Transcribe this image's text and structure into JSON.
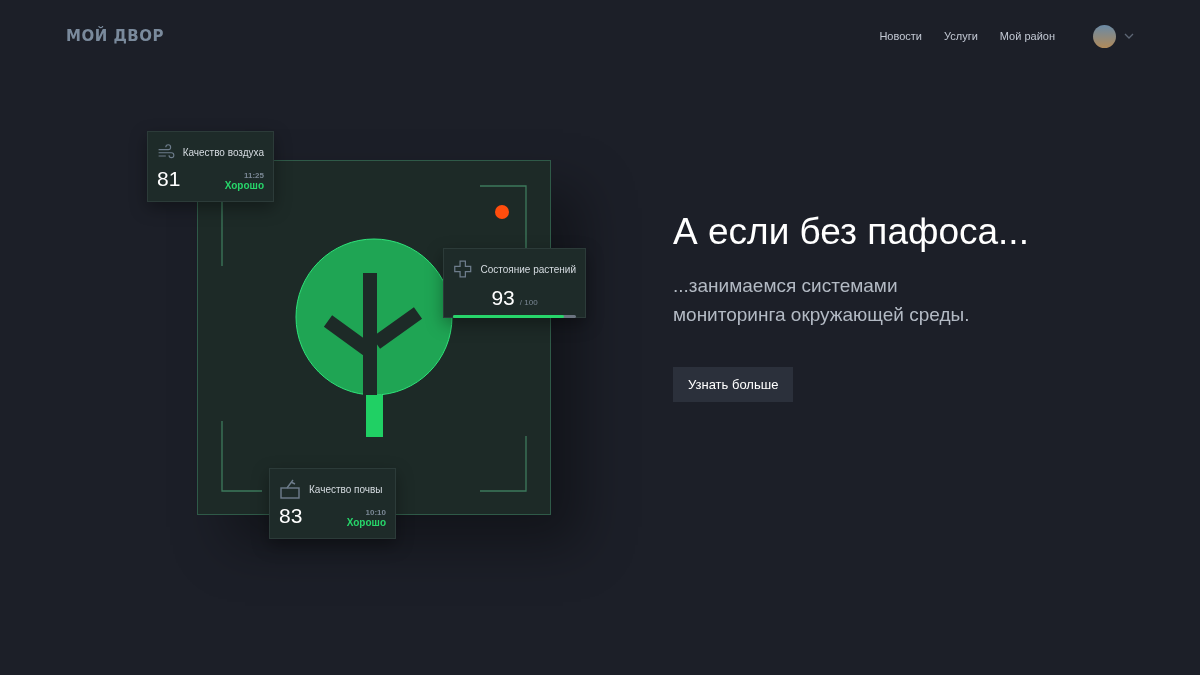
{
  "header": {
    "logo": "МОЙ ДВОР",
    "nav": [
      "Новости",
      "Услуги",
      "Мой район"
    ]
  },
  "illustration": {
    "cards": [
      {
        "kind": "metric",
        "title": "Качество воздуха",
        "value": "81",
        "time": "11:25",
        "status": "Хорошо"
      },
      {
        "kind": "progress",
        "title": "Состояние растений",
        "value": "93",
        "max": "/ 100",
        "level": 0.9
      },
      {
        "kind": "metric",
        "title": "Качество почвы",
        "value": "83",
        "time": "10:10",
        "status": "Хорошо"
      }
    ]
  },
  "hero": {
    "heading": "А если без пафоса...",
    "subtitle": "...занимаемся системами мониторинга окружающей среды.",
    "button": "Узнать больше"
  }
}
